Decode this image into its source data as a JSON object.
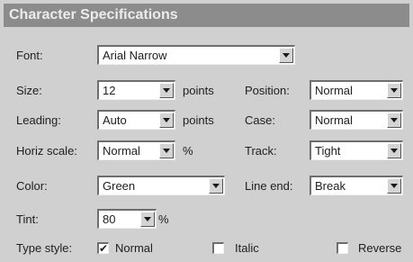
{
  "dialog": {
    "title": "Character Specifications"
  },
  "font": {
    "label": "Font:",
    "value": "Arial Narrow"
  },
  "size": {
    "label": "Size:",
    "value": "12",
    "unit": "points"
  },
  "position": {
    "label": "Position:",
    "value": "Normal"
  },
  "leading": {
    "label": "Leading:",
    "value": "Auto",
    "unit": "points"
  },
  "case": {
    "label": "Case:",
    "value": "Normal"
  },
  "horiz_scale": {
    "label": "Horiz scale:",
    "value": "Normal",
    "unit": "%"
  },
  "track": {
    "label": "Track:",
    "value": "Tight"
  },
  "color": {
    "label": "Color:",
    "value": "Green"
  },
  "line_end": {
    "label": "Line end:",
    "value": "Break"
  },
  "tint": {
    "label": "Tint:",
    "value": "80",
    "unit": "%"
  },
  "type_style": {
    "label": "Type style:",
    "normal": {
      "label": "Normal",
      "checked": true,
      "mark": "✔"
    },
    "italic": {
      "label": "Italic",
      "checked": false
    },
    "reverse": {
      "label": "Reverse",
      "checked": false
    }
  }
}
